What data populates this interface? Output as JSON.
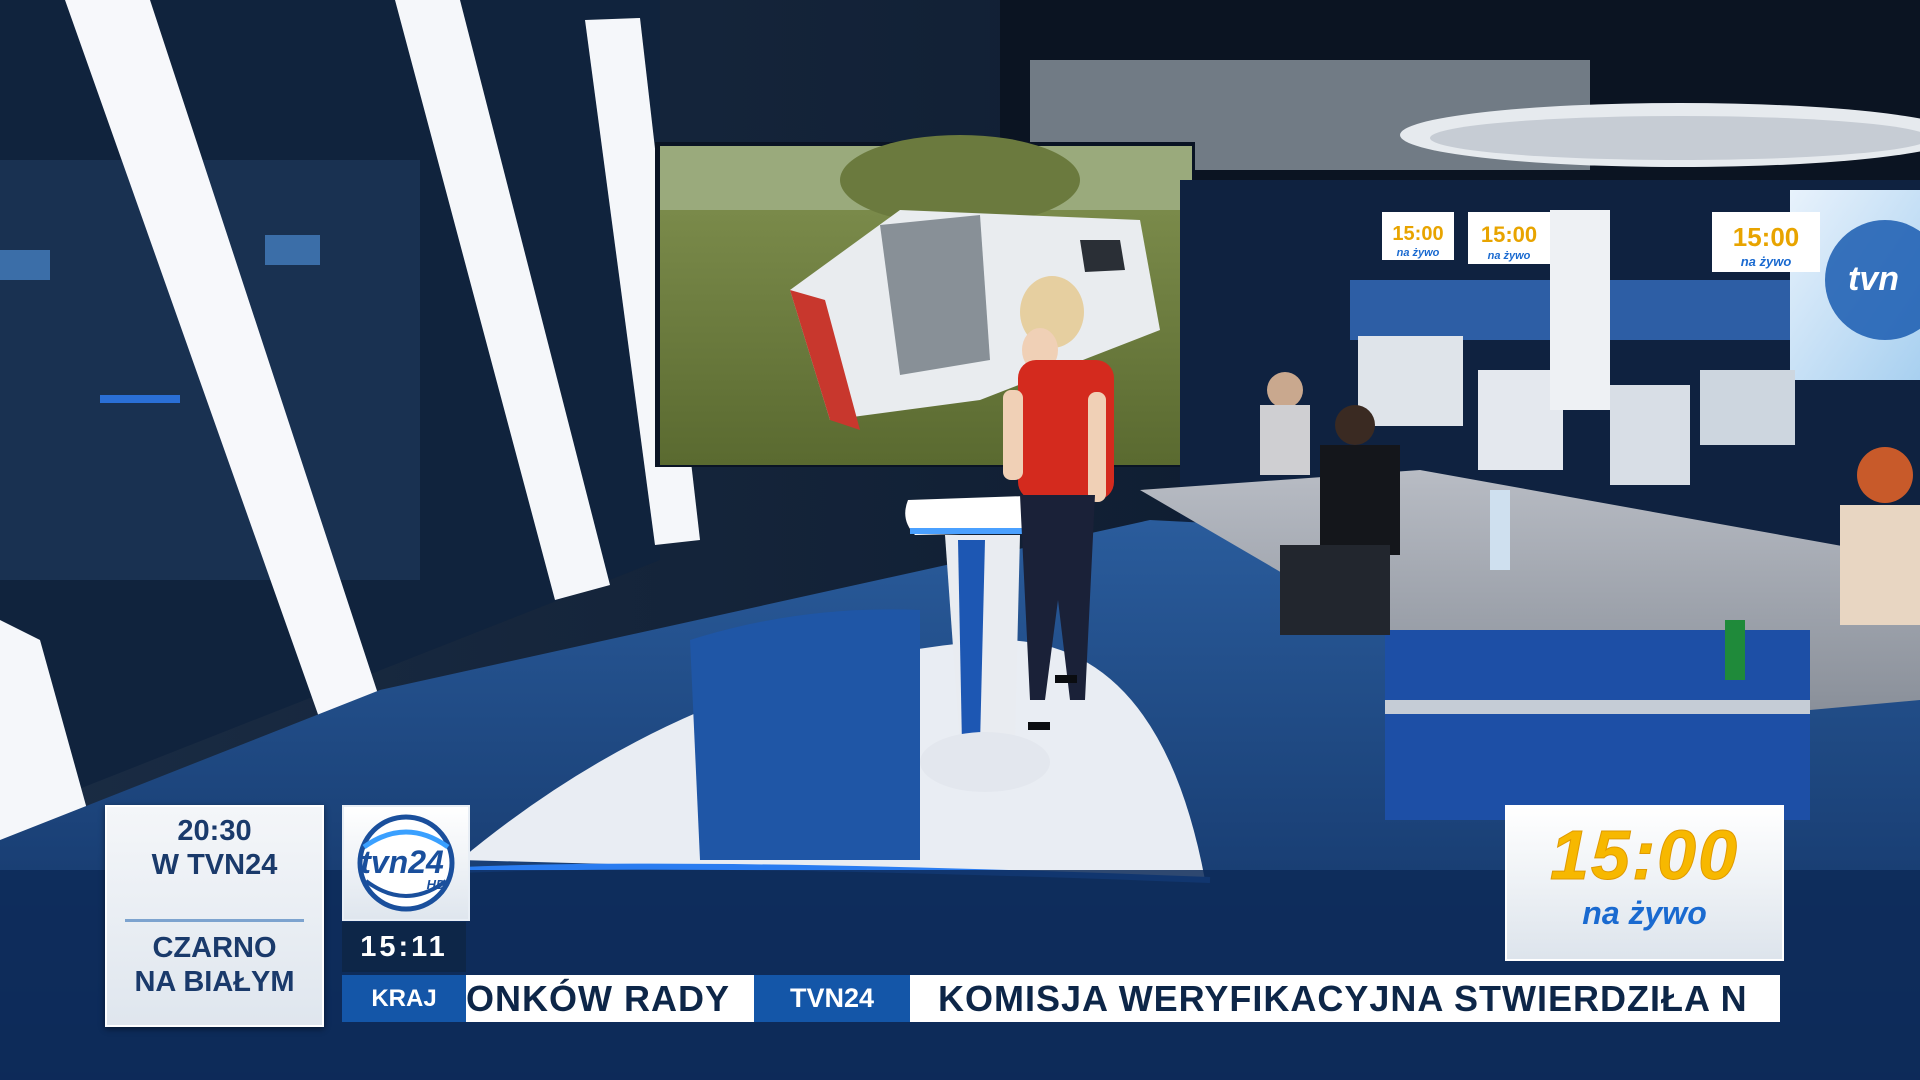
{
  "broadcast": {
    "promo": {
      "time": "20:30",
      "channel": "W TVN24",
      "show_line1": "CZARNO",
      "show_line2": "NA BIAŁYM"
    },
    "logo": {
      "name": "tvn24",
      "badge": "HD"
    },
    "clock": "15:11",
    "ticker": {
      "section_tag": "KRAJ",
      "segment_left": "ONKÓW RADY",
      "separator_label": "TVN24",
      "segment_right": "KOMISJA WERYFIKACYJNA STWIERDZIŁA N"
    },
    "live_badge": {
      "time": "15:00",
      "label": "na żywo"
    },
    "monitors": [
      {
        "time": "15:00",
        "label": "na żywo"
      },
      {
        "time": "15:00",
        "label": "na żywo"
      },
      {
        "time": "15:00",
        "label": "na żywo"
      }
    ]
  },
  "colors": {
    "brand_blue": "#1456a8",
    "navy": "#0d2648",
    "live_yellow": "#f7b800",
    "dress_red": "#d42a1e",
    "studio_blue": "#1e58b8"
  },
  "icons": [
    "tvn24-logo-icon"
  ]
}
